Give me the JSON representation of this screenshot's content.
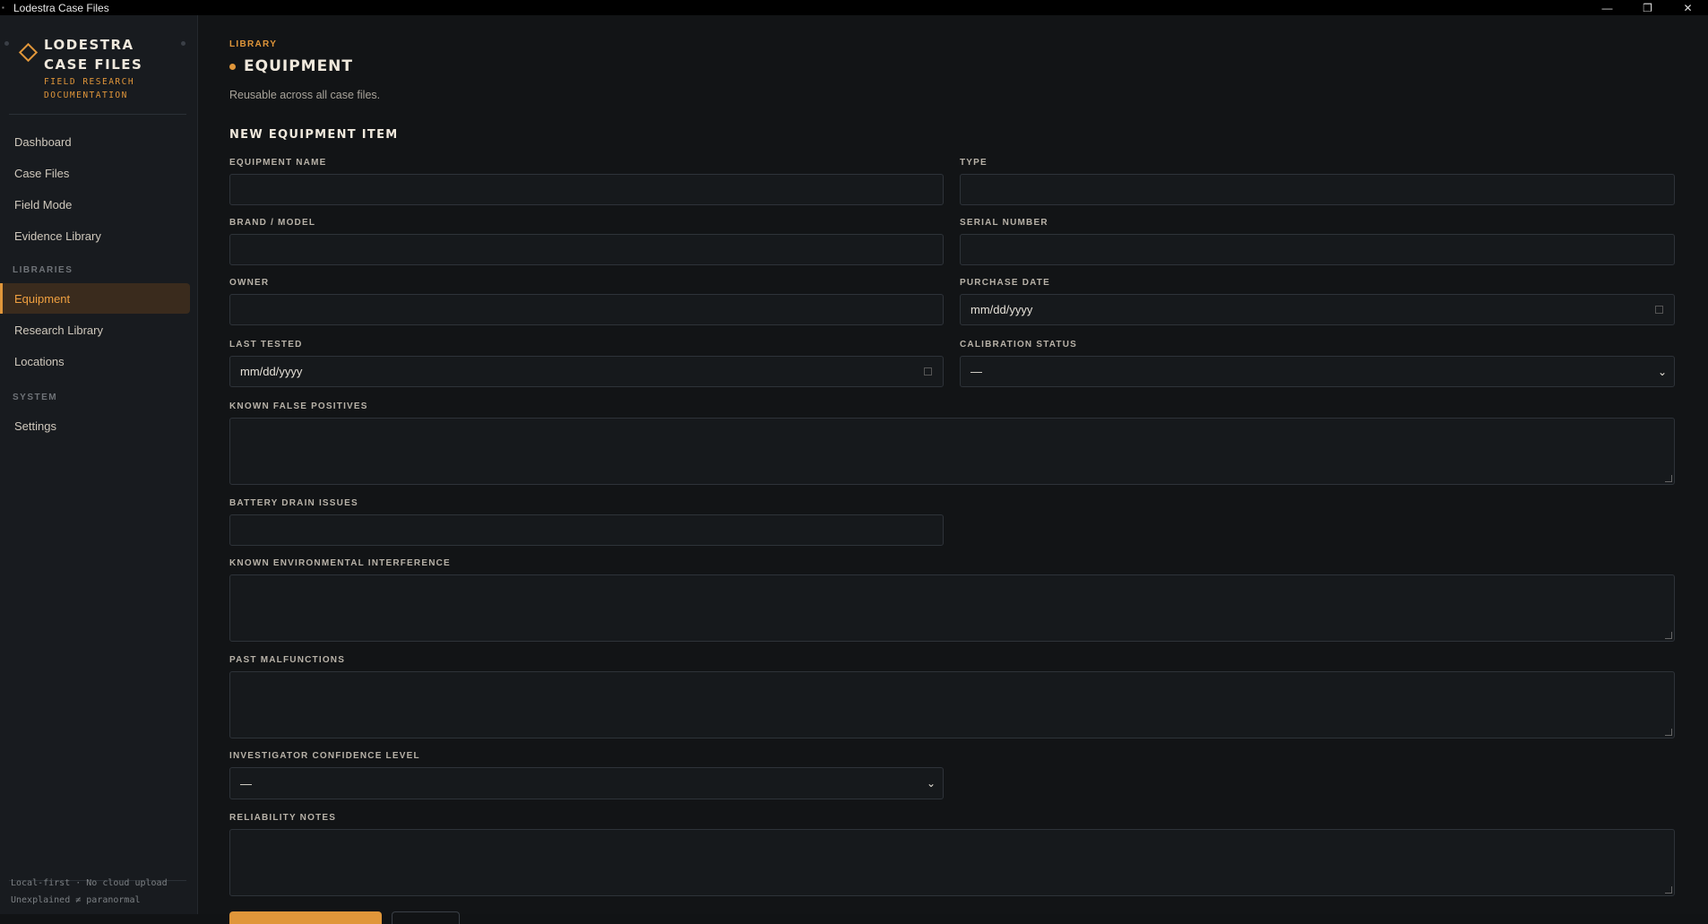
{
  "window": {
    "title": "Lodestra Case Files"
  },
  "brand": {
    "name_line1": "LODESTRA",
    "name_line2": "CASE FILES",
    "sub_line1": "FIELD RESEARCH",
    "sub_line2": "DOCUMENTATION"
  },
  "nav": {
    "items": [
      {
        "label": "Dashboard"
      },
      {
        "label": "Case Files"
      },
      {
        "label": "Field Mode"
      },
      {
        "label": "Evidence Library"
      }
    ],
    "libraries_heading": "LIBRARIES",
    "library_items": [
      {
        "label": "Equipment",
        "active": true
      },
      {
        "label": "Research Library"
      },
      {
        "label": "Locations"
      }
    ],
    "system_heading": "SYSTEM",
    "system_items": [
      {
        "label": "Settings"
      }
    ]
  },
  "footer": {
    "line1": "Local-first · No cloud upload",
    "line2": "Unexplained ≠ paranormal"
  },
  "page": {
    "eyebrow": "LIBRARY",
    "title": "EQUIPMENT",
    "subtitle": "Reusable across all case files."
  },
  "form": {
    "section_title": "NEW EQUIPMENT ITEM",
    "equipment_name": {
      "label": "EQUIPMENT NAME",
      "value": ""
    },
    "type": {
      "label": "TYPE",
      "value": ""
    },
    "brand_model": {
      "label": "BRAND / MODEL",
      "value": ""
    },
    "serial_number": {
      "label": "SERIAL NUMBER",
      "value": ""
    },
    "owner": {
      "label": "OWNER",
      "value": ""
    },
    "purchase_date": {
      "label": "PURCHASE DATE",
      "value": "mm/dd/yyyy"
    },
    "last_tested": {
      "label": "LAST TESTED",
      "value": "mm/dd/yyyy"
    },
    "calibration_status": {
      "label": "CALIBRATION STATUS",
      "value": "—"
    },
    "known_false_positives": {
      "label": "KNOWN FALSE POSITIVES",
      "value": ""
    },
    "battery_drain_issues": {
      "label": "BATTERY DRAIN ISSUES",
      "value": ""
    },
    "known_environmental_interference": {
      "label": "KNOWN ENVIRONMENTAL INTERFERENCE",
      "value": ""
    },
    "past_malfunctions": {
      "label": "PAST MALFUNCTIONS",
      "value": ""
    },
    "investigator_confidence_level": {
      "label": "INVESTIGATOR CONFIDENCE LEVEL",
      "value": "—"
    },
    "reliability_notes": {
      "label": "RELIABILITY NOTES",
      "value": ""
    }
  },
  "colors": {
    "accent": "#e0963a",
    "background": "#121416",
    "sidebar": "#181b1f",
    "field": "#16191c",
    "active_nav_bg": "#3a2b1d"
  },
  "icons": {
    "brand": "diamond-logo-icon",
    "calendar": "calendar-icon",
    "dropdown": "chevron-down-icon",
    "resize": "resize-grip-icon"
  }
}
